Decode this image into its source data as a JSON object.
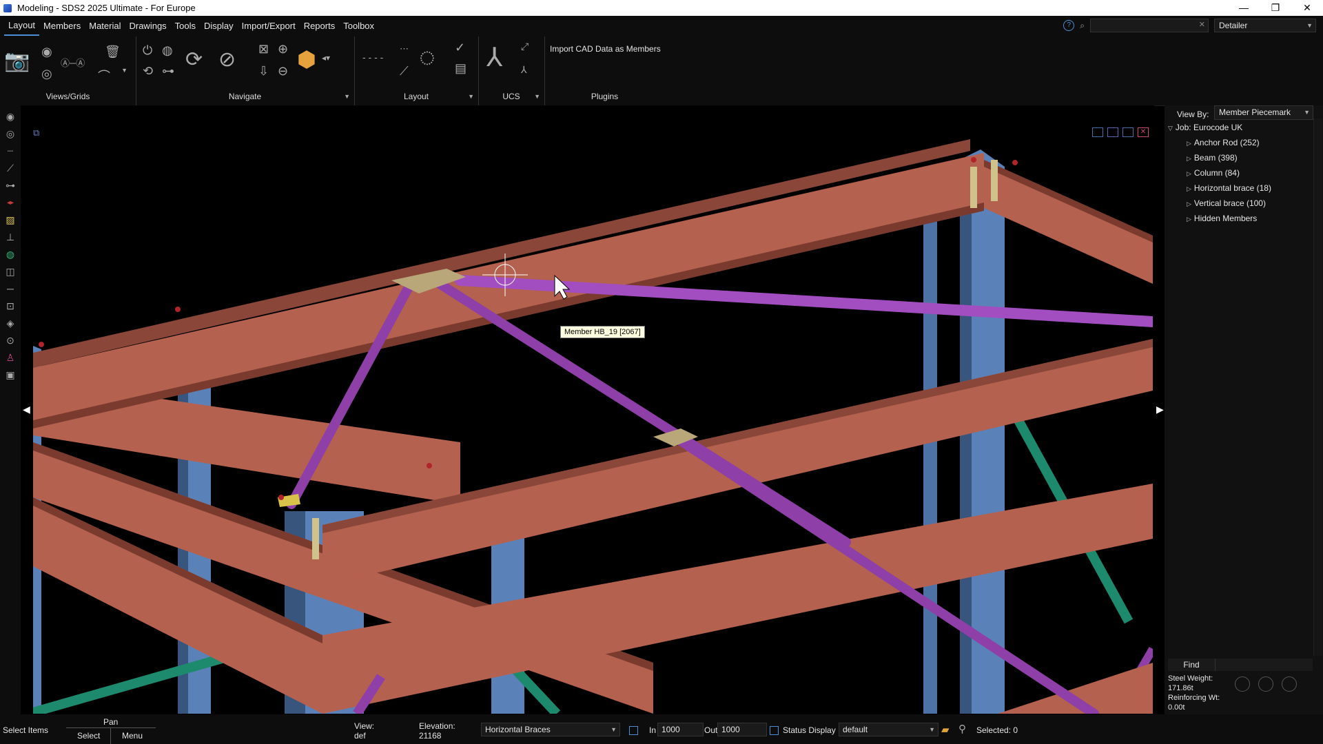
{
  "window": {
    "title": "Modeling - SDS2 2025 Ultimate - For Europe",
    "minimize": "—",
    "restore": "❐",
    "close": "✕"
  },
  "menu": {
    "items": [
      "Layout",
      "Members",
      "Material",
      "Drawings",
      "Tools",
      "Display",
      "Import/Export",
      "Reports",
      "Toolbox"
    ],
    "active": "Layout",
    "search_placeholder": "",
    "role": "Detailer"
  },
  "ribbon": {
    "groups": {
      "views_grids": "Views/Grids",
      "navigate": "Navigate",
      "layout": "Layout",
      "ucs": "UCS",
      "plugins": "Plugins"
    },
    "plugin_button": "Import CAD Data as Members"
  },
  "viewport": {
    "tooltip": "Member HB_19 [2067]",
    "colors": {
      "beam": "#b5614f",
      "beam_dark": "#7a3a2e",
      "column": "#5b82b8",
      "column_dark": "#38557d",
      "brace_horizontal": "#8e3fa8",
      "brace_vertical": "#1d8a6d",
      "plate": "#b9a77a"
    }
  },
  "panel": {
    "view_by_label": "View By:",
    "view_by_value": "Member Piecemark",
    "job": "Job: Eurocode UK",
    "tree": [
      "Anchor Rod (252)",
      "Beam (398)",
      "Column (84)",
      "Horizontal brace (18)",
      "Vertical brace (100)",
      "Hidden Members"
    ],
    "find_label": "Find",
    "steel_weight_label": "Steel Weight:",
    "steel_weight_value": "171.86t",
    "reinforcing_label": "Reinforcing Wt:",
    "reinforcing_value": "0.00t"
  },
  "status": {
    "mode": "Select Items",
    "pan": "Pan",
    "select": "Select",
    "menu": "Menu",
    "view_label": "View:",
    "view_value": "def",
    "elevation_label": "Elevation:",
    "elevation_value": "21168",
    "filter": "Horizontal Braces",
    "in_label": "In",
    "in_value": "1000",
    "out_label": "Out",
    "out_value": "1000",
    "status_display_label": "Status Display",
    "status_display_value": "default",
    "selected": "Selected: 0"
  }
}
